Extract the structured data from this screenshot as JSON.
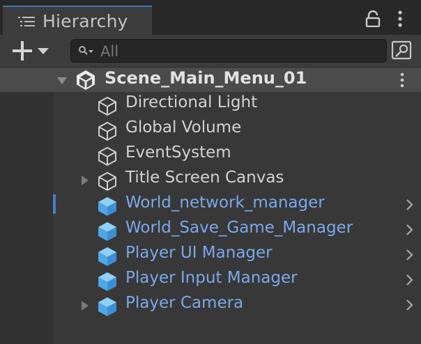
{
  "window": {
    "tab_title": "Hierarchy",
    "tab_icon": "list-icon",
    "lock_icon": "lock-icon",
    "menu_icon": "kebab-menu-icon"
  },
  "toolbar": {
    "add_icon": "plus-icon",
    "dropdown_icon": "caret-down-icon",
    "search": {
      "value": "",
      "placeholder": "All",
      "icon": "search-filter-icon"
    },
    "search_window_icon": "search-window-icon"
  },
  "scene": {
    "name": "Scene_Main_Menu_01",
    "icon": "unity-logo-icon",
    "expanded": true
  },
  "hierarchy": [
    {
      "name": "Directional Light",
      "kind": "gameobject",
      "prefab": false,
      "has_children": false
    },
    {
      "name": "Global Volume",
      "kind": "gameobject",
      "prefab": false,
      "has_children": false
    },
    {
      "name": "EventSystem",
      "kind": "gameobject",
      "prefab": false,
      "has_children": false
    },
    {
      "name": "Title Screen Canvas",
      "kind": "gameobject",
      "prefab": false,
      "has_children": true
    },
    {
      "name": "World_network_manager",
      "kind": "prefab",
      "prefab": true,
      "has_children": false
    },
    {
      "name": "World_Save_Game_Manager",
      "kind": "prefab",
      "prefab": true,
      "has_children": false
    },
    {
      "name": "Player UI Manager",
      "kind": "prefab",
      "prefab": true,
      "has_children": false
    },
    {
      "name": "Player Input Manager",
      "kind": "prefab",
      "prefab": true,
      "has_children": false
    },
    {
      "name": "Player Camera",
      "kind": "prefab",
      "prefab": true,
      "has_children": true
    }
  ],
  "colors": {
    "prefab_text": "#7aa8ec",
    "prefab_icon": "#5fb6ee",
    "normal_text": "#d2d2d2",
    "selection_indicator": "#3f7fd0"
  }
}
